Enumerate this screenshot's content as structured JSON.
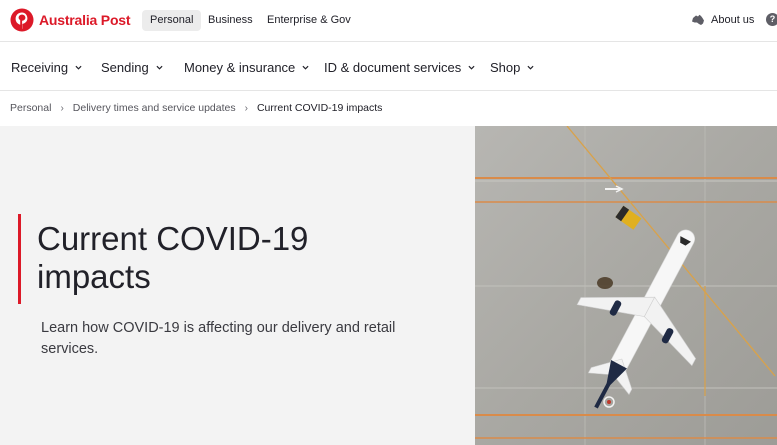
{
  "brand": {
    "name": "Australia Post",
    "color": "#dc1928",
    "icon": "australia-post-logo-icon"
  },
  "segments": [
    {
      "label": "Personal",
      "active": true
    },
    {
      "label": "Business",
      "active": false
    },
    {
      "label": "Enterprise & Gov",
      "active": false
    }
  ],
  "utility": {
    "about_label": "About us",
    "about_icon": "australia-map-icon",
    "help_icon": "help-icon",
    "help_glyph": "?"
  },
  "nav": {
    "items": [
      {
        "label": "Receiving"
      },
      {
        "label": "Sending"
      },
      {
        "label": "Money & insurance"
      },
      {
        "label": "ID & document services"
      },
      {
        "label": "Shop"
      }
    ],
    "chevron_icon": "chevron-down-icon"
  },
  "breadcrumb": {
    "items": [
      "Personal",
      "Delivery times and service updates"
    ],
    "current": "Current COVID-19 impacts",
    "separator": "›"
  },
  "hero": {
    "title": "Current COVID-19 impacts",
    "subtitle": "Learn how COVID-19 is affecting our delivery and retail services.",
    "accent_color": "#dc1928",
    "image_subject": "aerial view of aircraft on tarmac"
  }
}
